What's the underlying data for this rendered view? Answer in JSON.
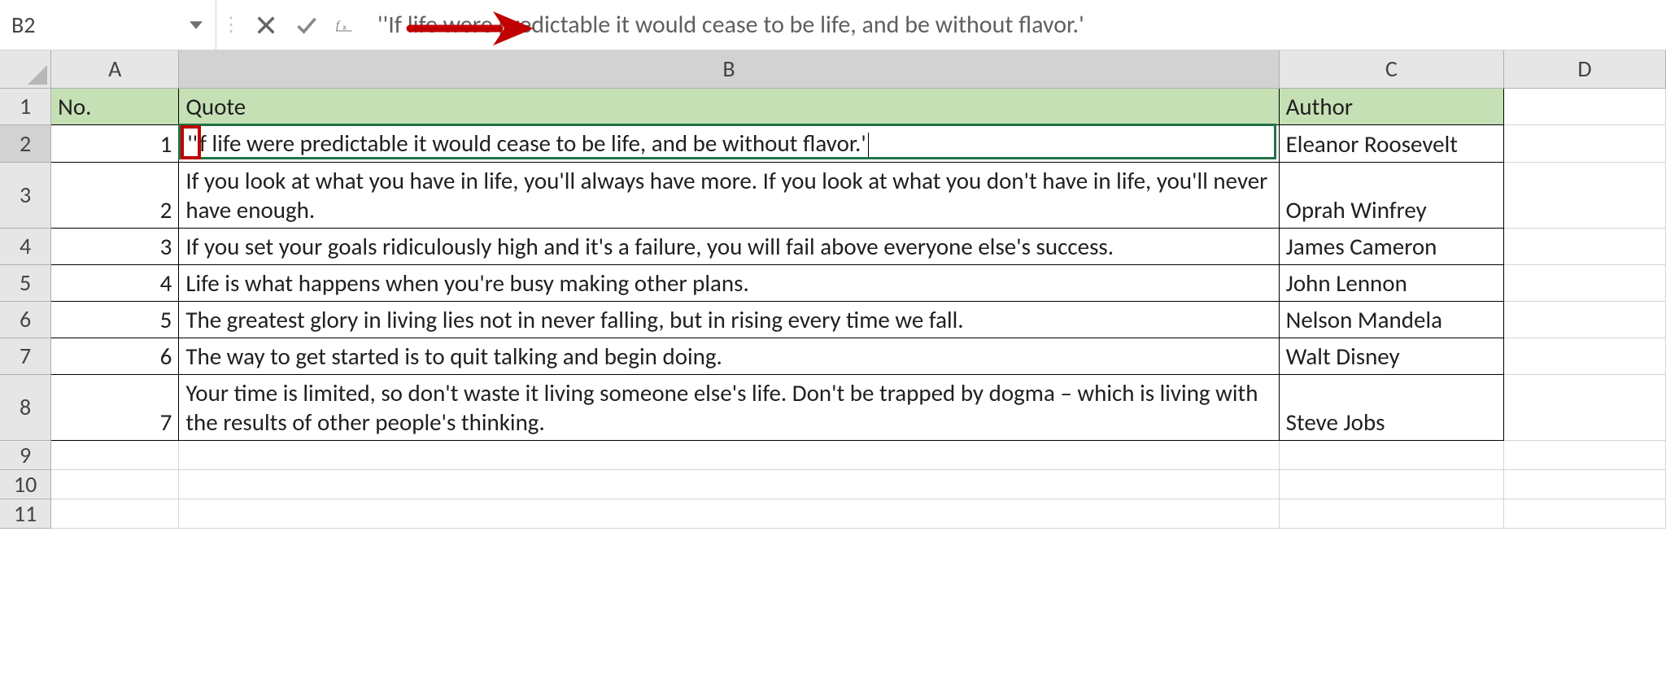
{
  "formula_bar": {
    "cell_ref": "B2",
    "content": "''If life were predictable it would cease to be life, and be without flavor.'"
  },
  "columns": [
    "A",
    "B",
    "C",
    "D"
  ],
  "selected_col": "B",
  "selected_row": "2",
  "headers": {
    "no": "No.",
    "quote": "Quote",
    "author": "Author"
  },
  "rows": [
    {
      "n": "1",
      "no": "1",
      "quote_lead": "''",
      "quote_rest": "f life were predictable it would cease to be life, and be without flavor.'",
      "author": "Eleanor Roosevelt",
      "editing": true
    },
    {
      "n": "2",
      "no": "2",
      "quote": "If you look at what you have in life, you'll always have more. If you look at what you don't have in life, you'll never have enough.",
      "author": "Oprah Winfrey"
    },
    {
      "n": "3",
      "no": "3",
      "quote": "If you set your goals ridiculously high and it's a failure, you will fail above everyone else's success.",
      "author": "James Cameron"
    },
    {
      "n": "4",
      "no": "4",
      "quote": "Life is what happens when you're busy making other plans.",
      "author": "John Lennon"
    },
    {
      "n": "5",
      "no": "5",
      "quote": "The greatest glory in living lies not in never falling, but in rising every time we fall.",
      "author": "Nelson Mandela"
    },
    {
      "n": "6",
      "no": "6",
      "quote": "The way to get started is to quit talking and begin doing.",
      "author": "Walt Disney"
    },
    {
      "n": "7",
      "no": "7",
      "quote": "Your time is limited, so don't waste it living someone else's life. Don't be trapped by dogma – which is living with the results of other people's thinking.",
      "author": "Steve Jobs"
    }
  ],
  "empty_rows": [
    "9",
    "10",
    "11"
  ]
}
